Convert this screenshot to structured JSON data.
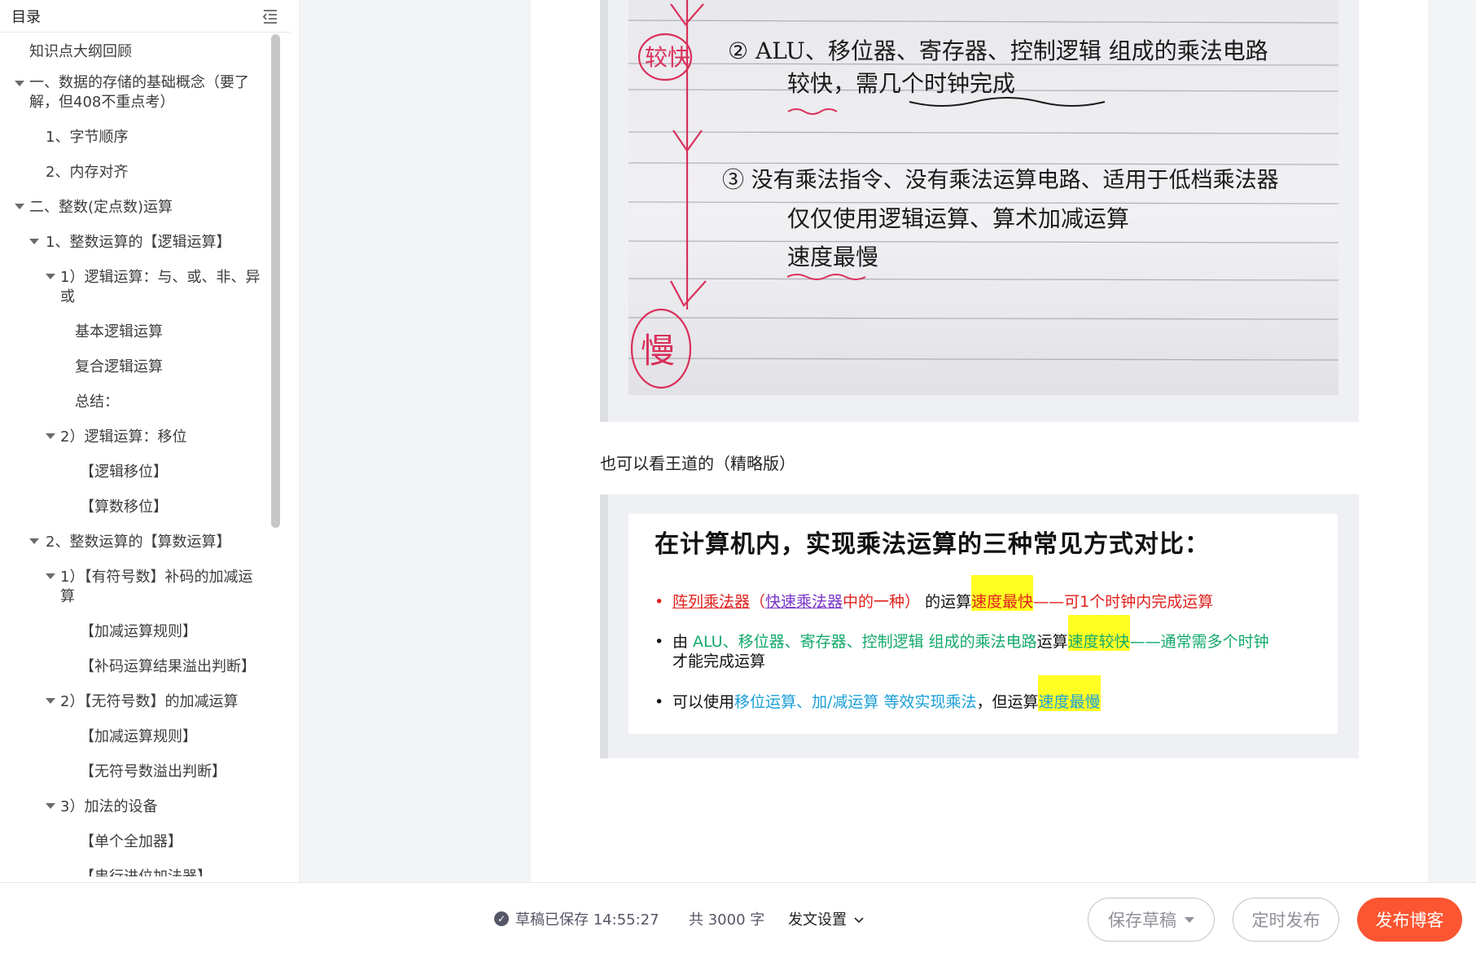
{
  "toc": {
    "title": "目录",
    "items": [
      {
        "label": "知识点大纲回顾"
      },
      {
        "label": "一、数据的存储的基础概念（要了解，但408不重点考）"
      },
      {
        "label": "1、字节顺序"
      },
      {
        "label": "2、内存对齐"
      },
      {
        "label": "二、整数(定点数)运算"
      },
      {
        "label": "1、整数运算的【逻辑运算】"
      },
      {
        "label": "1）逻辑运算：与、或、非、异或"
      },
      {
        "label": "基本逻辑运算"
      },
      {
        "label": "复合逻辑运算"
      },
      {
        "label": "总结："
      },
      {
        "label": "2）逻辑运算：移位"
      },
      {
        "label": "【逻辑移位】"
      },
      {
        "label": "【算数移位】"
      },
      {
        "label": "2、整数运算的【算数运算】"
      },
      {
        "label": "1）【有符号数】补码的加减运算"
      },
      {
        "label": "【加减运算规则】"
      },
      {
        "label": "【补码运算结果溢出判断】"
      },
      {
        "label": "2）【无符号数】的加减运算"
      },
      {
        "label": "【加减运算规则】"
      },
      {
        "label": "【无符号数溢出判断】"
      },
      {
        "label": "3）加法的设备"
      },
      {
        "label": "【单个全加器】"
      },
      {
        "label": "【串行进位加法器】"
      }
    ]
  },
  "content": {
    "note_image": {
      "mark_top": "较快",
      "line2": "② ALU、移位器、寄存器、控制逻辑 组成的乘法电路",
      "line2b": "较快，需几个时钟完成",
      "line3": "③ 没有乘法指令、没有乘法运算电路、适用于低档乘法器",
      "line3b": "仅仅使用逻辑运算、算术加减运算",
      "line3c": "速度最慢",
      "mark_bottom": "慢"
    },
    "paragraph": "也可以看王道的（精略版）",
    "slide": {
      "title": "在计算机内，实现乘法运算的三种常见方式对比：",
      "b1": {
        "p1": "阵列乘法器",
        "p2": "（",
        "p3": "快速乘法器",
        "p4": "中的一种）",
        "p5": " 的运算",
        "p6": "速度最快",
        "p7": "——可1个时钟内完成运算"
      },
      "b2": {
        "p1": "由 ",
        "p2": "ALU、移位器、寄存器、控制逻辑 组成的乘法电路",
        "p3": "运算",
        "p4": "速度较快",
        "p5": "——通常需多个时钟",
        "p6": "才能完成运算"
      },
      "b3": {
        "p1": "可以使用",
        "p2": "移位运算、加/减运算 等效实现乘法",
        "p3": "，但运算",
        "p4": "速度最慢"
      }
    }
  },
  "bottombar": {
    "saved": "草稿已保存 14:55:27",
    "count": "共 3000 字",
    "settings": "发文设置",
    "save_draft": "保存草稿",
    "schedule": "定时发布",
    "publish": "发布博客"
  },
  "colors": {
    "publish": "#fc5531",
    "highlight": "#ffff24",
    "red": "#e0201d",
    "green": "#13a96b",
    "blue": "#1a9fd8",
    "purple": "#7a35c8"
  }
}
